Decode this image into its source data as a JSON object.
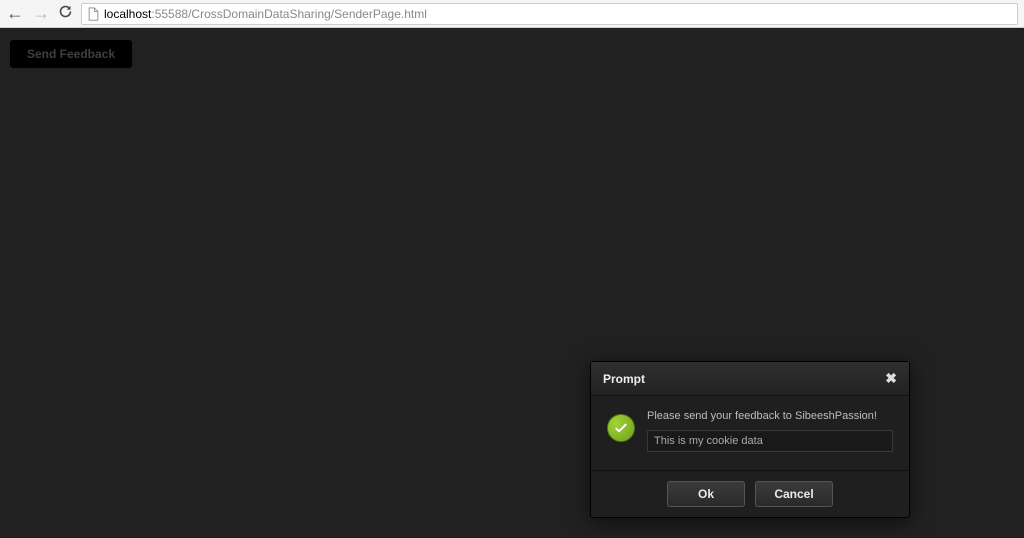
{
  "browser": {
    "url_host": "localhost",
    "url_rest": ":55588/CrossDomainDataSharing/SenderPage.html"
  },
  "page": {
    "feedback_button_label": "Send Feedback"
  },
  "modal": {
    "title": "Prompt",
    "message": "Please send your feedback to SibeeshPassion!",
    "input_value": "This is my cookie data",
    "ok_label": "Ok",
    "cancel_label": "Cancel"
  }
}
